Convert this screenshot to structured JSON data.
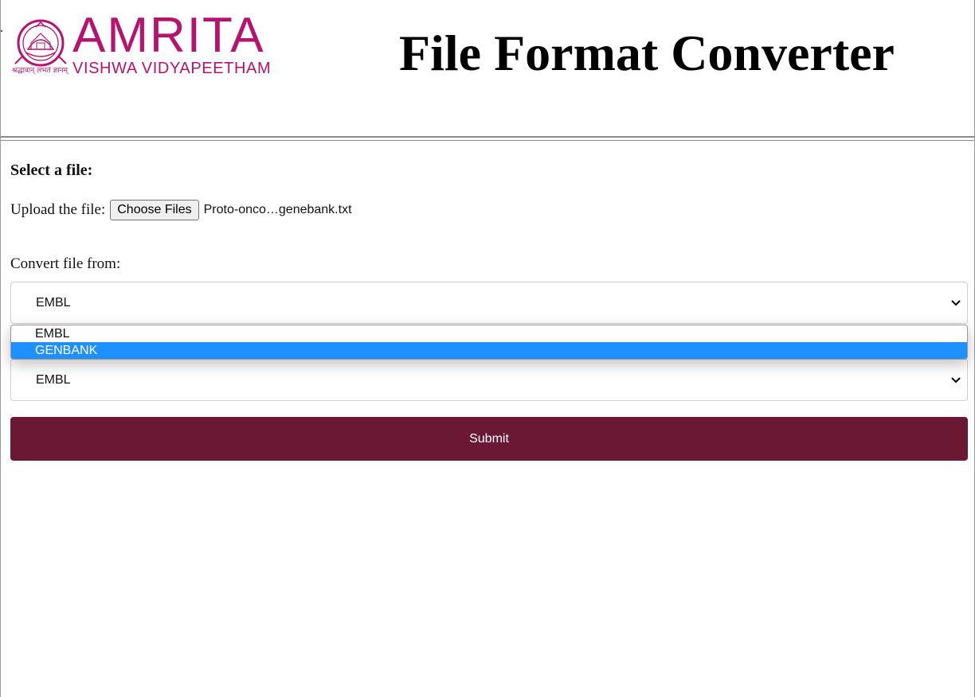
{
  "header": {
    "logo": {
      "wordmark": "AMRITA",
      "subtitle": "VISHWA VIDYAPEETHAM",
      "tagline": "श्रद्धावान् लभते ज्ञानम्",
      "emblem_icon": "amrita-emblem-icon",
      "color": "#b5136f"
    },
    "title": "File Format Converter"
  },
  "form": {
    "heading": "Select a file:",
    "upload": {
      "label": "Upload the file:",
      "button_label": "Choose Files",
      "file_name": "Proto-onco…genebank.txt"
    },
    "convert_from": {
      "label": "Convert file from:",
      "selected": "EMBL",
      "chevron_icon": "chevron-down-icon",
      "open": true,
      "options": [
        {
          "label": "EMBL",
          "highlighted": false
        },
        {
          "label": "GENBANK",
          "highlighted": true
        }
      ]
    },
    "convert_to": {
      "selected": "EMBL",
      "chevron_icon": "chevron-down-icon"
    },
    "submit_label": "Submit"
  },
  "colors": {
    "brand": "#b5136f",
    "submit_bg": "#6a1834",
    "option_highlight": "#1e90ff"
  }
}
